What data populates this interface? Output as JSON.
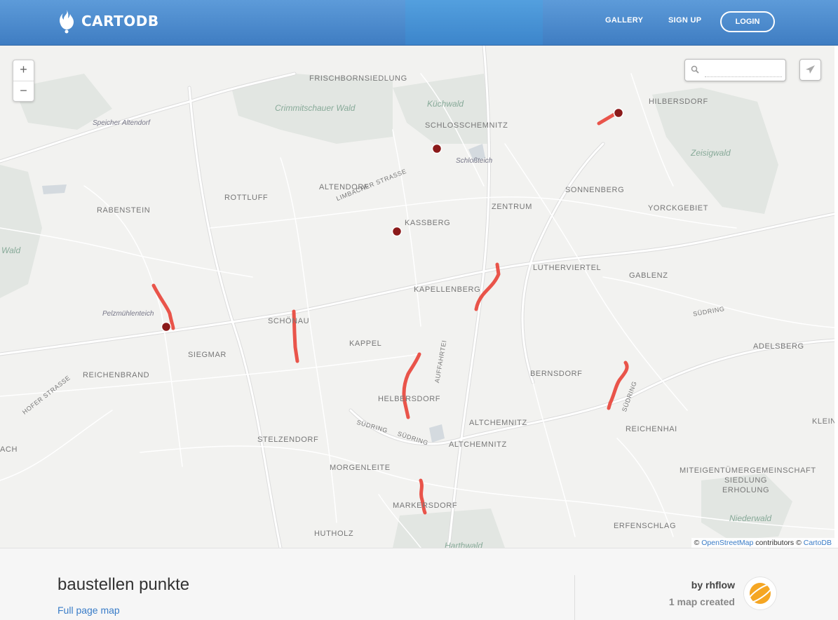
{
  "header": {
    "brand": "CARTODB",
    "nav": {
      "gallery": "GALLERY",
      "signup": "SIGN UP",
      "login": "LOGIN"
    }
  },
  "map": {
    "zoom_in": "+",
    "zoom_out": "−",
    "search_placeholder": "",
    "attribution": {
      "prefix": "© ",
      "osm": "OpenStreetMap",
      "middle": " contributors © ",
      "carto": "CartoDB"
    },
    "labels": {
      "frischbornsiedlung": "FRISCHBORNSIEDLUNG",
      "crimmitschauer_wald": "Crimmitschauer Wald",
      "kuchwald": "Küchwald",
      "schlosschemnitz": "SCHLOSSCHEMNITZ",
      "hilbersdorf": "HILBERSDORF",
      "speicher_altendorf": "Speicher Altendorf",
      "schlossteich": "Schloßteich",
      "zeisigwald": "Zeisigwald",
      "altendorf": "ALTENDORF",
      "sonnenberg": "SONNENBERG",
      "rottluff": "ROTTLUFF",
      "limbacher_strasse": "LIMBACHER STRASSE",
      "zentrum": "ZENTRUM",
      "yorckgebiet": "YORCKGEBIET",
      "rabenstein": "RABENSTEIN",
      "kassberg": "KASSBERG",
      "wald": "Wald",
      "lutherviertel": "LUTHERVIERTEL",
      "gablenz": "GABLENZ",
      "kapellenberg": "KAPELLENBERG",
      "pelzmuhlenteich": "Pelzmühlenteich",
      "schonau": "SCHÖNAU",
      "sudring1": "SÜDRING",
      "kappel": "KAPPEL",
      "adelsberg": "ADELSBERG",
      "siegmar": "SIEGMAR",
      "reichenbrand": "REICHENBRAND",
      "bernsdorf": "BERNSDORF",
      "helbersdorf": "HELBERSDORF",
      "sudring2": "SÜDRING",
      "altchemnitz1": "ALTCHEMNITZ",
      "reichenhai": "REICHENHAI",
      "klein": "KLEIN",
      "stelzendorf": "STELZENDORF",
      "sudring3": "SÜDRING",
      "altchemnitz2": "ALTCHEMNITZ",
      "ach": "ACH",
      "morgenleite": "MORGENLEITE",
      "miteigentumer": "MITEIGENTÜMERGEMEINSCHAFT",
      "siedlung": "SIEDLUNG",
      "erholung": "ERHOLUNG",
      "markersdorf": "MARKERSDORF",
      "niederwald": "Niederwald",
      "erfenschlag": "ERFENSCHLAG",
      "hutholz": "HUTHOLZ",
      "harthwald": "Harthwald",
      "hofer_strasse": "HOFER STRASSE",
      "sudring4": "SÜDRING",
      "auffahrt": "AUFFAHRTEI"
    }
  },
  "footer": {
    "title": "baustellen punkte",
    "full_page_link": "Full page map",
    "author": "by rhflow",
    "maps_created": "1 map created"
  },
  "colors": {
    "accent": "#3f7dc2",
    "segment": "#e8463c",
    "point": "#8b1a1a"
  }
}
